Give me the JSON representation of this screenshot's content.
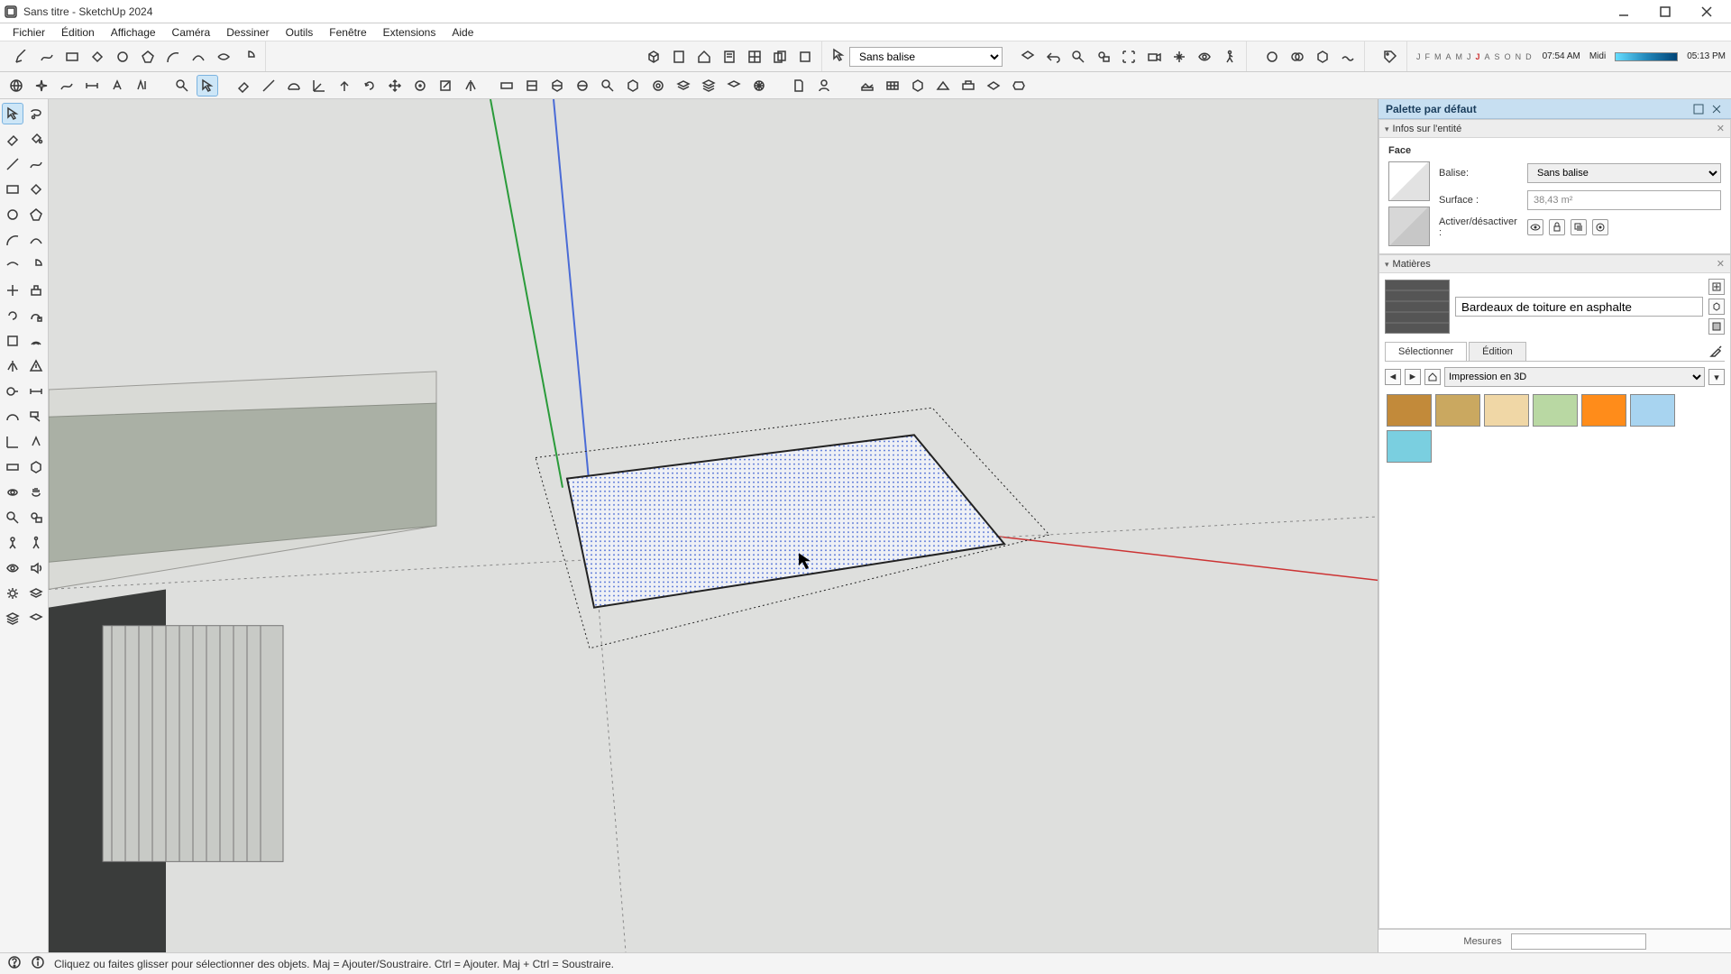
{
  "title": "Sans titre - SketchUp 2024",
  "menu": [
    "Fichier",
    "Édition",
    "Affichage",
    "Caméra",
    "Dessiner",
    "Outils",
    "Fenêtre",
    "Extensions",
    "Aide"
  ],
  "tag_select": "Sans balise",
  "months": [
    "J",
    "F",
    "M",
    "A",
    "M",
    "J",
    "J",
    "A",
    "S",
    "O",
    "N",
    "D"
  ],
  "time_left": "07:54 AM",
  "time_mid": "Midi",
  "time_right": "05:13 PM",
  "tray_title": "Palette par défaut",
  "entity_section": "Infos sur l'entité",
  "entity_type": "Face",
  "labels": {
    "balise": "Balise:",
    "surface": "Surface :",
    "toggle": "Activer/désactiver :"
  },
  "entity_balise": "Sans balise",
  "entity_surface": "38,43 m²",
  "materials_section": "Matières",
  "material_name": "Bardeaux de toiture en asphalte",
  "mat_tab_select": "Sélectionner",
  "mat_tab_edit": "Édition",
  "mat_library": "Impression en 3D",
  "swatches": [
    "#c28a3a",
    "#caa860",
    "#f0d7a6",
    "#b9d8a3",
    "#ff8c1a",
    "#a8d4f0",
    "#7acfe0"
  ],
  "status_hint": "Cliquez ou faites glisser pour sélectionner des objets. Maj = Ajouter/Soustraire. Ctrl = Ajouter. Maj + Ctrl = Soustraire.",
  "measures_label": "Mesures",
  "measures_value": ""
}
